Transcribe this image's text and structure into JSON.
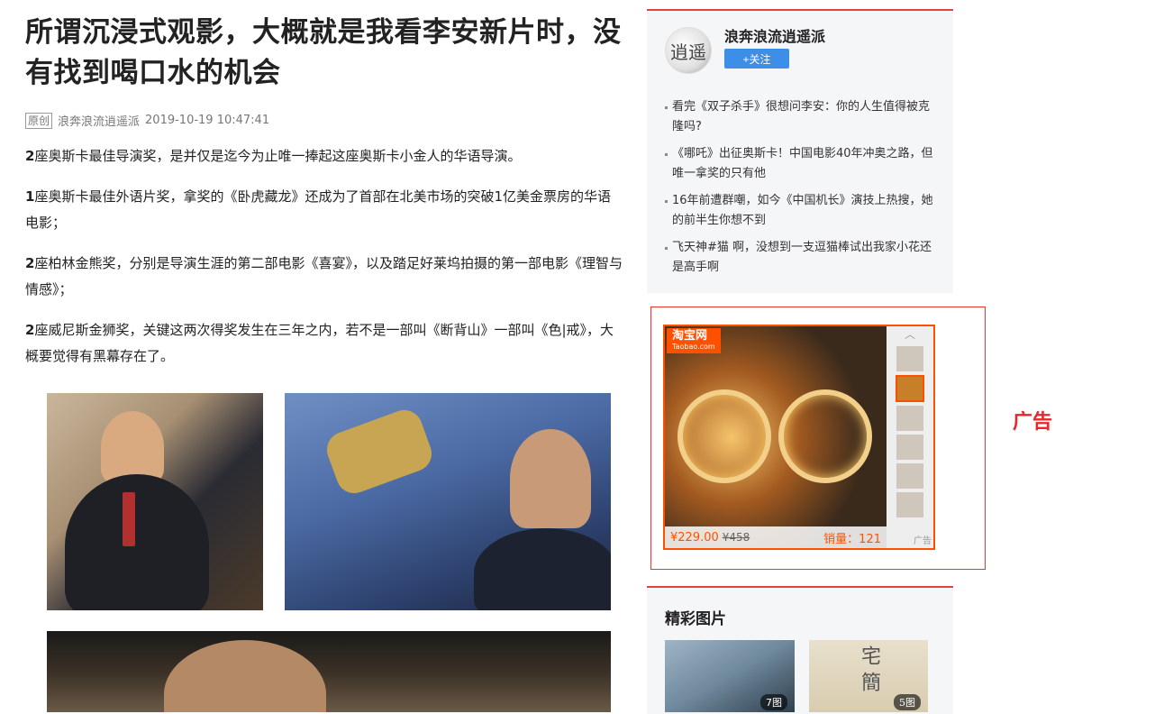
{
  "article": {
    "title": "所谓沉浸式观影，大概就是我看李安新片时，没有找到喝口水的机会",
    "original_tag": "原创",
    "author": "浪奔浪流逍遥派",
    "datetime": "2019-10-19 10:47:41",
    "paragraphs": [
      {
        "num": "2",
        "text": "座奥斯卡最佳导演奖，是并仅是迄今为止唯一捧起这座奥斯卡小金人的华语导演。"
      },
      {
        "num": "1",
        "text": "座奥斯卡最佳外语片奖，拿奖的《卧虎藏龙》还成为了首部在北美市场的突破1亿美金票房的华语电影；"
      },
      {
        "num": "2",
        "text": "座柏林金熊奖，分别是导演生涯的第二部电影《喜宴》，以及踏足好莱坞拍摄的第一部电影《理智与情感》；"
      },
      {
        "num": "2",
        "text": "座威尼斯金狮奖，关键这两次得奖发生在三年之内，若不是一部叫《断背山》一部叫《色|戒》，大概要觉得有黑幕存在了。"
      }
    ]
  },
  "sidebar": {
    "author_name": "浪奔浪流逍遥派",
    "avatar_text": "逍遥",
    "follow_label": "+关注",
    "related": [
      "看完《双子杀手》很想问李安：你的人生值得被克隆吗?",
      "《哪吒》出征奥斯卡！中国电影40年冲奥之路，但唯一拿奖的只有他",
      "16年前遭群嘲，如今《中国机长》演技上热搜，她的前半生你想不到",
      "飞天神#猫 啊，没想到一支逗猫棒试出我家小花还是高手啊"
    ]
  },
  "ad": {
    "brand": "淘宝网",
    "brand_sub": "Taobao.com",
    "price": "¥229.00",
    "original_price": "¥458",
    "sales": "销量：121",
    "tag": "广告",
    "up_arrow": "︿",
    "annotation": "广告"
  },
  "gallery": {
    "heading": "精彩图片",
    "items": [
      {
        "count": "7图"
      },
      {
        "count": "5图",
        "text": "宅 簡"
      }
    ]
  }
}
